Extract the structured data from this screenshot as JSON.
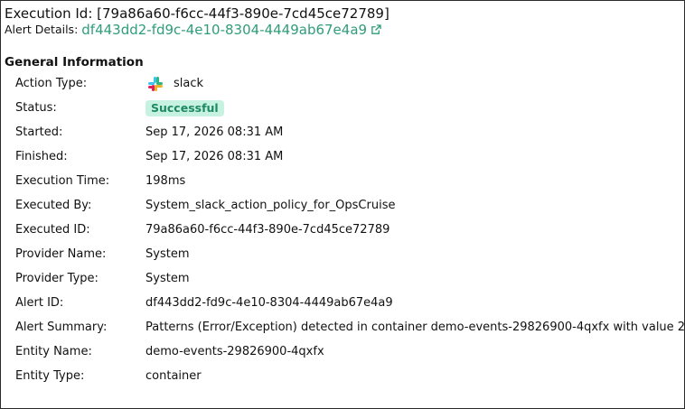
{
  "header": {
    "execution_title": "Execution Id: [79a86a60-f6cc-44f3-890e-7cd45ce72789]",
    "alert_details_label": "Alert Details:",
    "alert_details_link": "df443dd2-fd9c-4e10-8304-4449ab67e4a9",
    "external_link_icon": "external-link-icon"
  },
  "section": {
    "title": "General Information"
  },
  "fields": {
    "action_type": {
      "label": "Action Type:",
      "value": "slack",
      "icon": "slack-icon"
    },
    "status": {
      "label": "Status:",
      "value": "Successful"
    },
    "started": {
      "label": "Started:",
      "value": "Sep 17, 2026 08:31 AM"
    },
    "finished": {
      "label": "Finished:",
      "value": "Sep 17, 2026 08:31 AM"
    },
    "execution_time": {
      "label": "Execution Time:",
      "value": "198ms"
    },
    "executed_by": {
      "label": "Executed By:",
      "value": "System_slack_action_policy_for_OpsCruise"
    },
    "executed_id": {
      "label": "Executed ID:",
      "value": "79a86a60-f6cc-44f3-890e-7cd45ce72789"
    },
    "provider_name": {
      "label": "Provider Name:",
      "value": "System"
    },
    "provider_type": {
      "label": "Provider Type:",
      "value": "System"
    },
    "alert_id": {
      "label": "Alert ID:",
      "value": "df443dd2-fd9c-4e10-8304-4449ab67e4a9"
    },
    "alert_summary": {
      "label": "Alert Summary:",
      "value": "Patterns (Error/Exception) detected in container demo-events-29826900-4qxfx with value 2"
    },
    "entity_name": {
      "label": "Entity Name:",
      "value": "demo-events-29826900-4qxfx"
    },
    "entity_type": {
      "label": "Entity Type:",
      "value": "container"
    }
  },
  "colors": {
    "link": "#2f9c7a",
    "status_badge_bg": "#c7f2e1",
    "status_badge_text": "#1d8a63",
    "border": "#2b2b2b"
  }
}
